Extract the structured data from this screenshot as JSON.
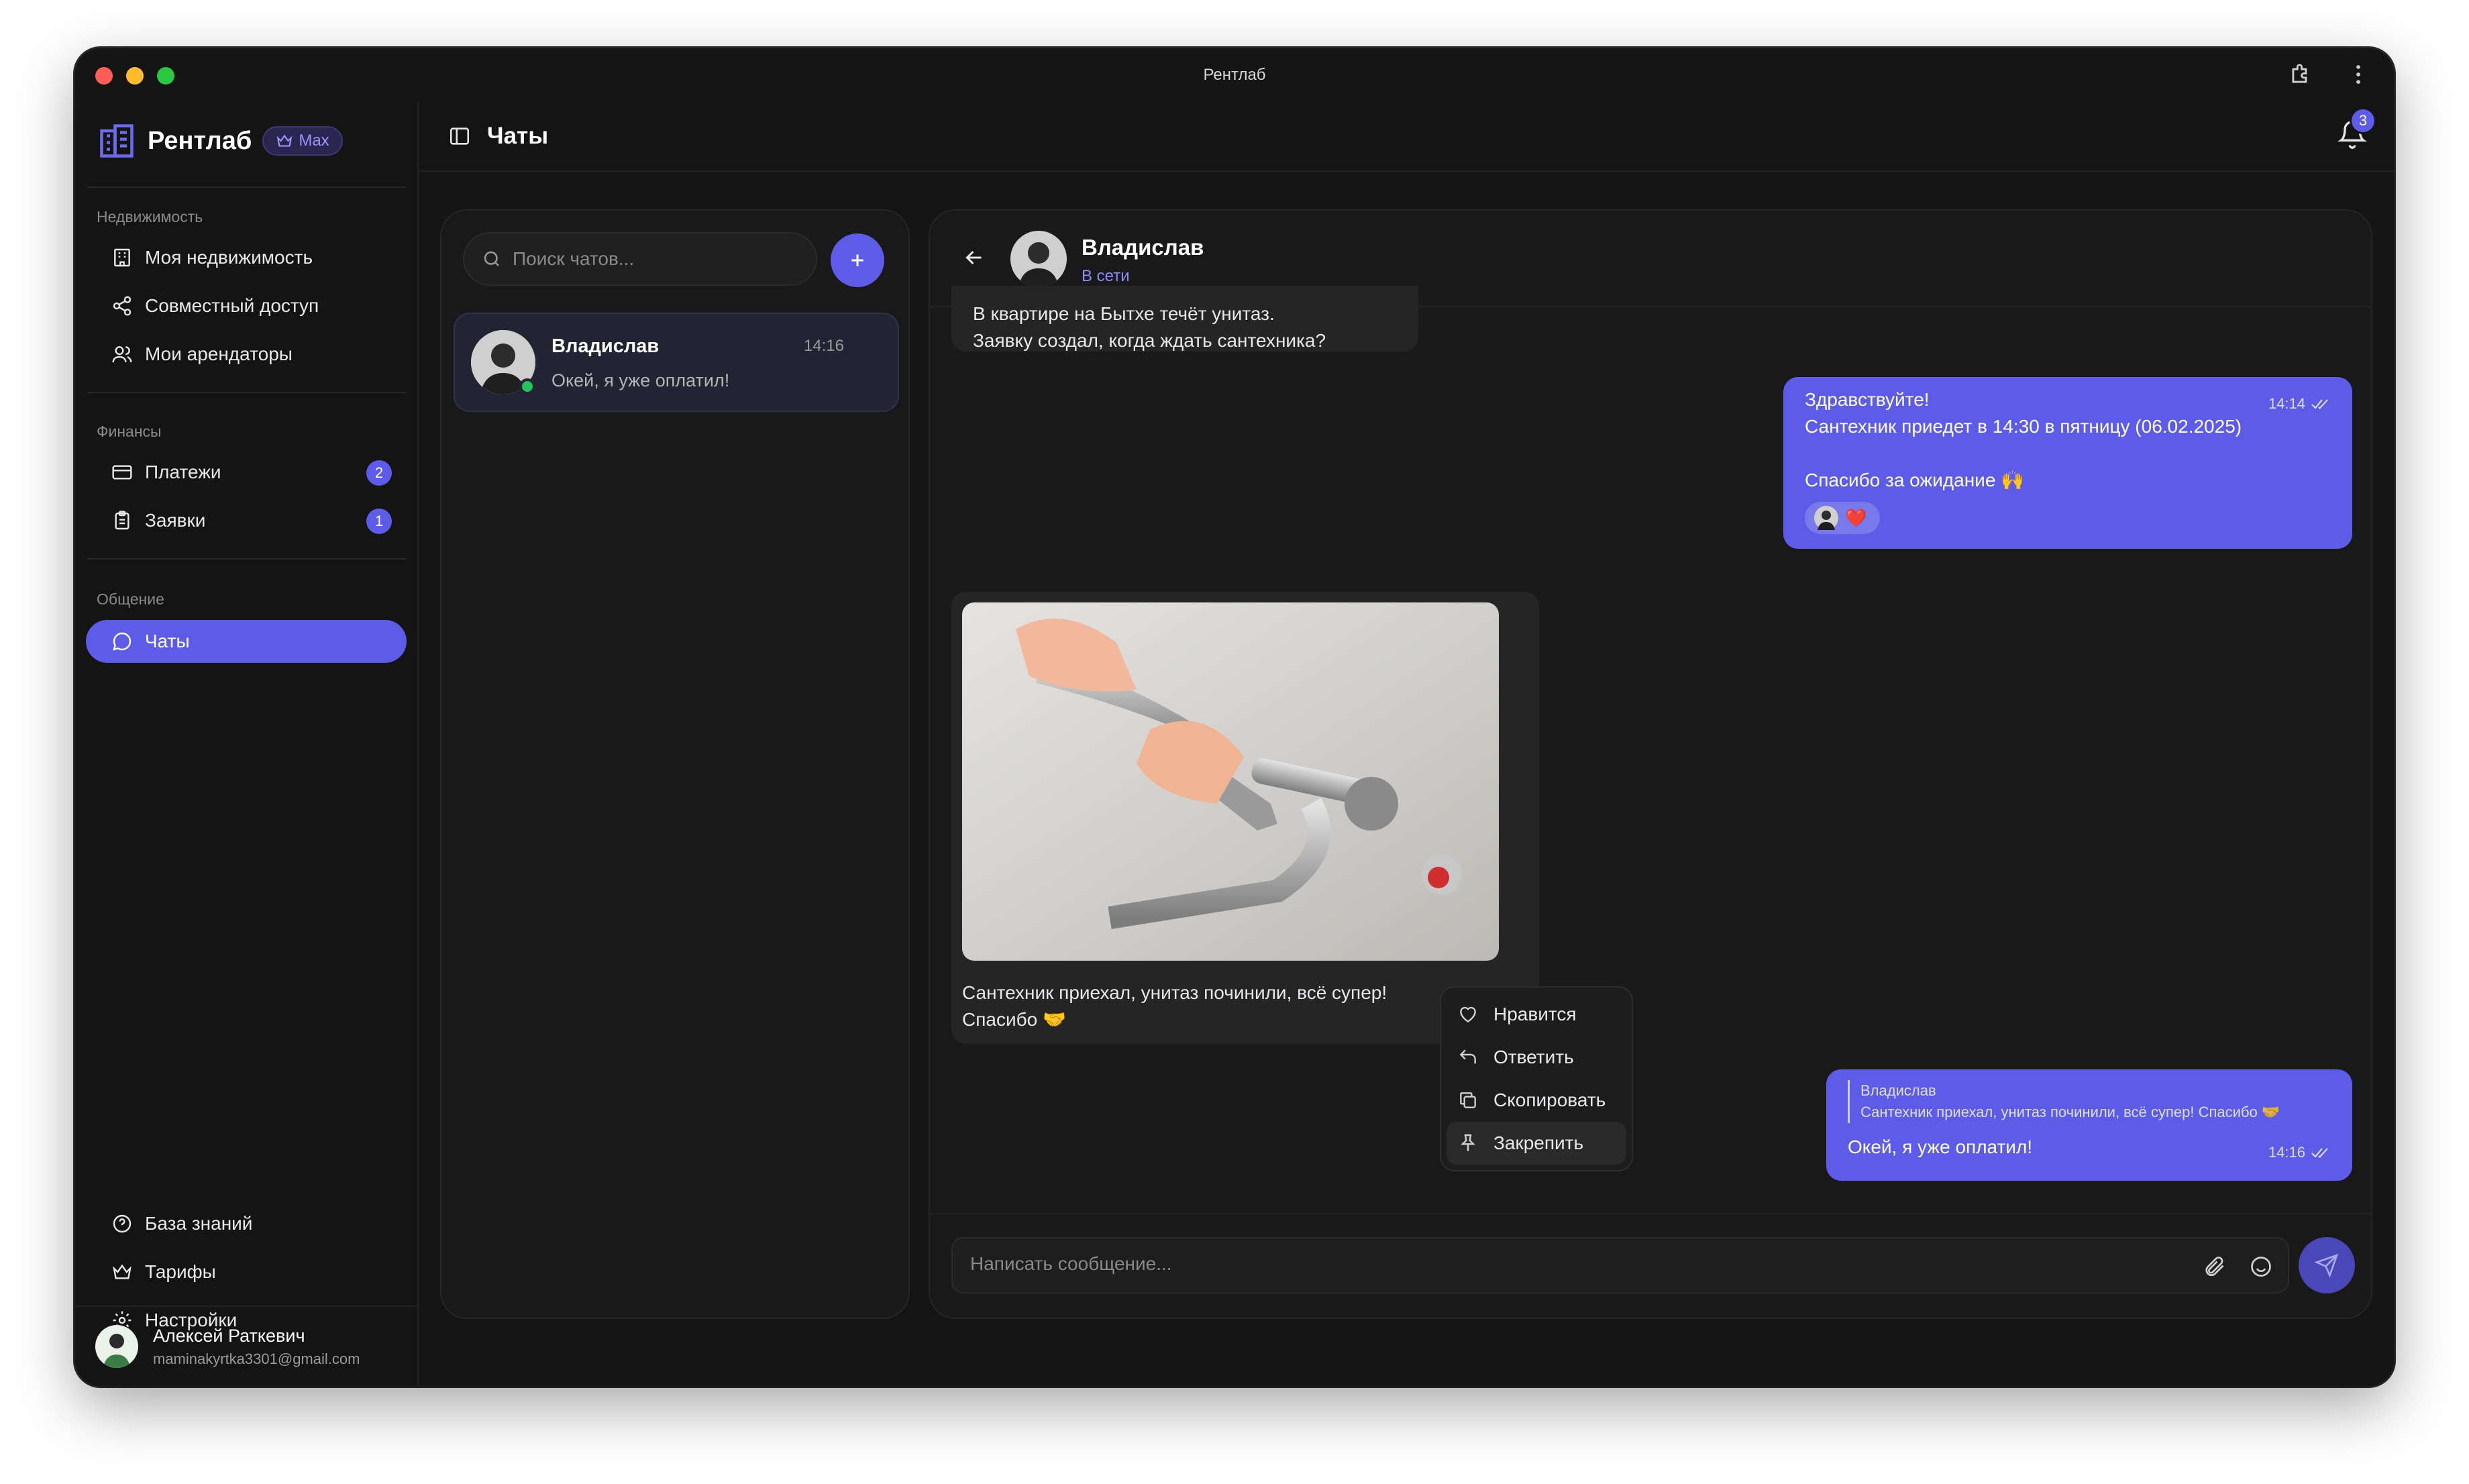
{
  "window": {
    "title": "Рентлаб"
  },
  "brand": {
    "name": "Рентлаб",
    "plan": "Max",
    "accent": "#5d5ce8"
  },
  "sidebar": {
    "sections": [
      {
        "label": "Недвижимость",
        "items": [
          {
            "label": "Моя недвижимость",
            "icon": "building-icon"
          },
          {
            "label": "Совместный доступ",
            "icon": "share-icon"
          },
          {
            "label": "Мои арендаторы",
            "icon": "users-icon"
          }
        ]
      },
      {
        "label": "Финансы",
        "items": [
          {
            "label": "Платежи",
            "icon": "card-icon",
            "count": "2"
          },
          {
            "label": "Заявки",
            "icon": "clipboard-icon",
            "count": "1"
          }
        ]
      },
      {
        "label": "Общение",
        "items": [
          {
            "label": "Чаты",
            "icon": "chat-icon",
            "active": true
          }
        ]
      }
    ],
    "bottom": [
      {
        "label": "База знаний",
        "icon": "help-icon"
      },
      {
        "label": "Тарифы",
        "icon": "crown-icon"
      },
      {
        "label": "Настройки",
        "icon": "gear-icon"
      }
    ],
    "user": {
      "name": "Алексей Раткевич",
      "email": "maminakyrtka3301@gmail.com"
    }
  },
  "header": {
    "title": "Чаты",
    "notifications": "3"
  },
  "chat_list": {
    "search_placeholder": "Поиск чатов...",
    "items": [
      {
        "name": "Владислав",
        "time": "14:16",
        "preview": "Окей, я уже оплатил!"
      }
    ]
  },
  "conversation": {
    "contact": {
      "name": "Владислав",
      "status": "В сети"
    },
    "messages": [
      {
        "from": "in",
        "lines": [
          "В квартире на Бытхе течёт унитаз.",
          "Заявку создал, когда ждать сантехника?"
        ]
      },
      {
        "from": "out",
        "time": "14:14",
        "lines": [
          "Здравствуйте!",
          "Сантехник приедет в 14:30 в пятницу (06.02.2025)",
          "",
          "Спасибо за ожидание 🙌"
        ],
        "reactions": [
          "avatar",
          "❤️"
        ]
      },
      {
        "from": "in",
        "image": "plumber-photo",
        "lines": [
          "Сантехник приехал, унитаз починили, всё супер!",
          "Спасибо 🤝"
        ]
      },
      {
        "from": "out",
        "time": "14:16",
        "reply_to": {
          "name": "Владислав",
          "text": "Сантехник приехал, унитаз починили, всё супер! Спасибо 🤝"
        },
        "lines": [
          "Окей, я уже оплатил!"
        ]
      }
    ],
    "composer_placeholder": "Написать сообщение..."
  },
  "context_menu": {
    "items": [
      {
        "label": "Нравится",
        "icon": "heart-icon"
      },
      {
        "label": "Ответить",
        "icon": "reply-icon"
      },
      {
        "label": "Скопировать",
        "icon": "copy-icon"
      },
      {
        "label": "Закрепить",
        "icon": "pin-icon"
      }
    ]
  }
}
